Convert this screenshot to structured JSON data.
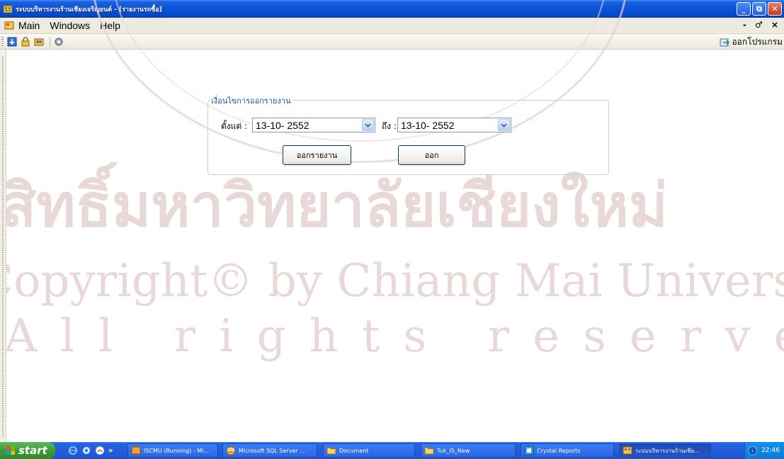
{
  "window": {
    "title": "ระบบบริหารงานร้านเชียงเจริญยนต์ - [รายงานรถซื้อ]",
    "minimize_label": "_",
    "restore_label": "⧉",
    "close_label": "✕"
  },
  "menubar": {
    "items": [
      "Main",
      "Windows",
      "Help"
    ],
    "mdi_controls": "- ♂ ×"
  },
  "toolbar": {
    "exit_label": "ออกโปรแกรม"
  },
  "form": {
    "group_title": "เงื่อนไขการออกรายงาน",
    "from_label": "ตั้งแต่ :",
    "from_value": "13-10- 2552",
    "to_label": "ถึง :",
    "to_value": "13-10- 2552",
    "report_button": "ออกรายงาน",
    "exit_button": "ออก"
  },
  "watermark": {
    "line1": "สิทธิ์มหาวิทยาลัยเชียงใหม่",
    "line2": "Copyright© by Chiang Mai University",
    "line3": "All rights reserved",
    "seal_text": "CHIANG MAI UNIVERSITY"
  },
  "taskbar": {
    "start_label": "start",
    "more_label": "»",
    "tasks": [
      "ISCMU (Running) - Mi...",
      "Microsoft SQL Server ...",
      "Document",
      "Tuk_IS_New",
      "Crystal Reports",
      "ระบบบริหารงานร้านเชีย..."
    ],
    "clock": "22:46"
  }
}
